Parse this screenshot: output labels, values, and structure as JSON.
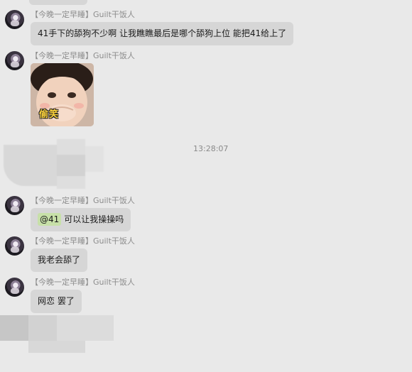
{
  "chat": {
    "timestamp": "13:28:07",
    "messages": [
      {
        "sender": "【今晚一定早睡】Guilt干饭人",
        "text": "41手下的舔狗不少啊 让我瞧瞧最后是哪个舔狗上位 能把41给上了"
      },
      {
        "sender": "【今晚一定早睡】Guilt干饭人",
        "sticker_caption": "偷笑"
      },
      {
        "sender": "【今晚一定早睡】Guilt干饭人",
        "mention": "@41",
        "text": "可以让我操操吗"
      },
      {
        "sender": "【今晚一定早睡】Guilt干饭人",
        "text": "我老会舔了"
      },
      {
        "sender": "【今晚一定早睡】Guilt干饭人",
        "text": "网恋 罢了"
      }
    ]
  },
  "colors": {
    "background": "#e9e9e9",
    "bubble": "#d6d6d6",
    "mention_highlight": "#c7e0a8",
    "sender_text": "#8c8c8c",
    "sticker_caption": "#ffd43b"
  }
}
